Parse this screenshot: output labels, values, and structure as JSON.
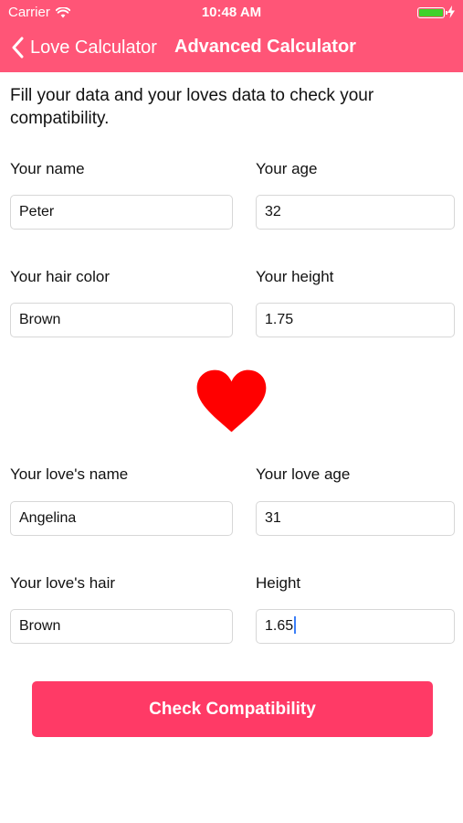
{
  "status_bar": {
    "carrier": "Carrier",
    "time": "10:48 AM",
    "battery_color": "#3fd22b"
  },
  "nav": {
    "back_label": "Love Calculator",
    "title": "Advanced Calculator",
    "bar_color": "#ff5577"
  },
  "intro_text": "Fill your data and your loves data to check your compatibility.",
  "your_data": {
    "name": {
      "label": "Your name",
      "value": "Peter"
    },
    "age": {
      "label": "Your age",
      "value": "32"
    },
    "hair": {
      "label": "Your hair color",
      "value": "Brown"
    },
    "height": {
      "label": "Your height",
      "value": "1.75"
    }
  },
  "love_data": {
    "name": {
      "label": "Your love's name",
      "value": "Angelina"
    },
    "age": {
      "label": "Your love age",
      "value": "31"
    },
    "hair": {
      "label": "Your love's hair",
      "value": "Brown"
    },
    "height": {
      "label": "Height",
      "value": "1.65"
    }
  },
  "heart_color": "#ff0000",
  "button": {
    "label": "Check Compatibility",
    "color": "#ff3a66"
  },
  "icons": [
    "wifi-icon",
    "battery-icon",
    "charge-icon",
    "chevron-left-icon",
    "heart-icon"
  ]
}
